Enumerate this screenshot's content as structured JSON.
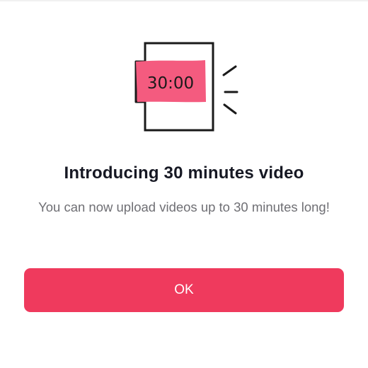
{
  "dialog": {
    "illustration": {
      "timer_text": "30:00",
      "icon_name": "video-duration-illustration"
    },
    "title": "Introducing 30 minutes video",
    "message": "You can now upload videos up to 30 minutes long!",
    "ok_label": "OK"
  },
  "colors": {
    "accent": "#ef3a5d",
    "title": "#161823",
    "message": "#6f6f74",
    "band": "#f45b7f"
  }
}
